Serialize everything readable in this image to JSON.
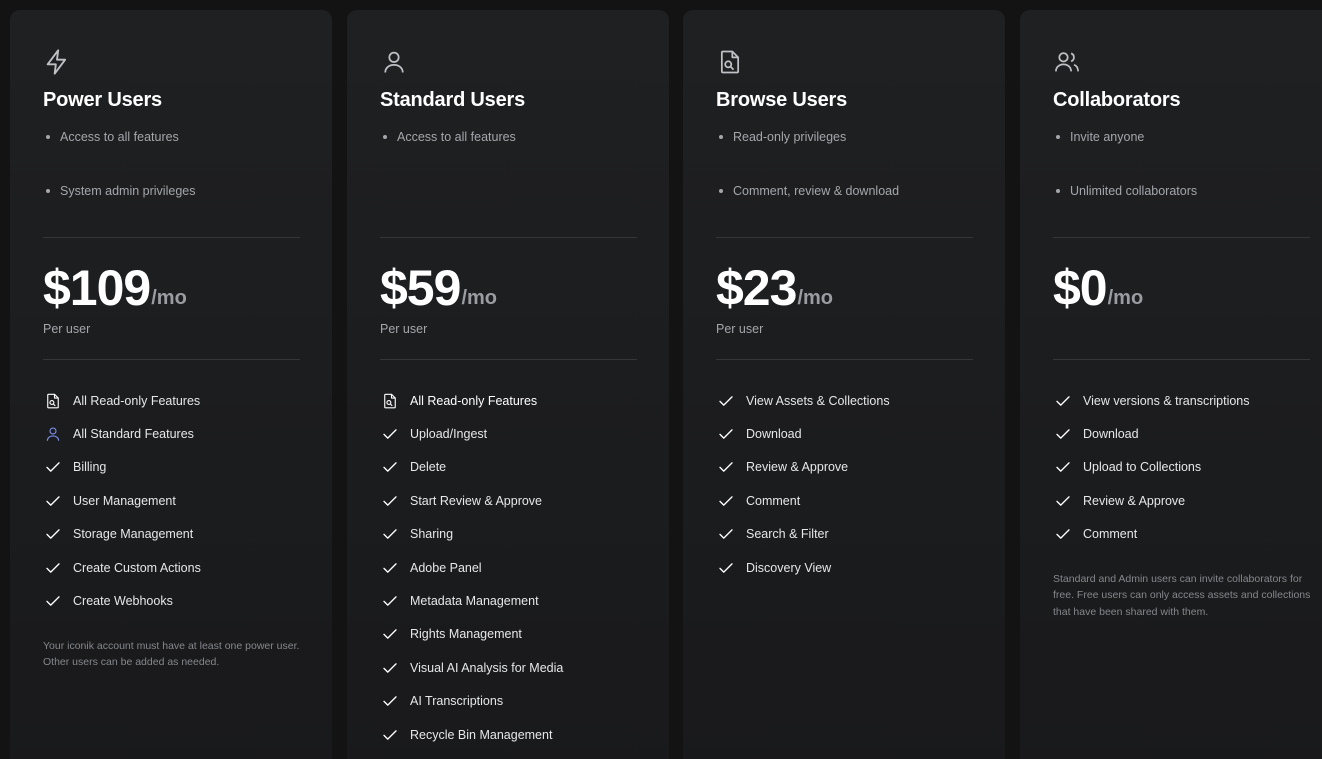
{
  "plans": [
    {
      "title": "Power Users",
      "icon": "lightning-icon",
      "bullets": [
        "Access to all features",
        "System admin privileges"
      ],
      "price": "$109",
      "period": "/mo",
      "per_user": "Per user",
      "features": [
        {
          "label": "All Read-only Features",
          "icon": "file-search-icon"
        },
        {
          "label": "All Standard Features",
          "icon": "user-icon"
        },
        {
          "label": "Billing",
          "icon": "check-icon"
        },
        {
          "label": "User Management",
          "icon": "check-icon"
        },
        {
          "label": "Storage Management",
          "icon": "check-icon"
        },
        {
          "label": "Create Custom Actions",
          "icon": "check-icon"
        },
        {
          "label": "Create Webhooks",
          "icon": "check-icon"
        }
      ],
      "note": "Your iconik account must have at least one power user. Other users can be added as needed."
    },
    {
      "title": "Standard Users",
      "icon": "user-icon",
      "bullets": [
        "Access to all features"
      ],
      "price": "$59",
      "period": "/mo",
      "per_user": "Per user",
      "features": [
        {
          "label": "All Read-only Features",
          "icon": "file-search-icon"
        },
        {
          "label": "Upload/Ingest",
          "icon": "check-icon"
        },
        {
          "label": "Delete",
          "icon": "check-icon"
        },
        {
          "label": "Start Review & Approve",
          "icon": "check-icon"
        },
        {
          "label": "Sharing",
          "icon": "check-icon"
        },
        {
          "label": "Adobe Panel",
          "icon": "check-icon"
        },
        {
          "label": "Metadata Management",
          "icon": "check-icon"
        },
        {
          "label": "Rights Management",
          "icon": "check-icon"
        },
        {
          "label": "Visual AI Analysis for Media",
          "icon": "check-icon"
        },
        {
          "label": "AI Transcriptions",
          "icon": "check-icon"
        },
        {
          "label": "Recycle Bin Management",
          "icon": "check-icon"
        }
      ],
      "note": ""
    },
    {
      "title": "Browse Users",
      "icon": "file-search-icon",
      "bullets": [
        "Read-only privileges",
        "Comment, review & download"
      ],
      "price": "$23",
      "period": "/mo",
      "per_user": "Per user",
      "features": [
        {
          "label": "View Assets & Collections",
          "icon": "check-icon"
        },
        {
          "label": "Download",
          "icon": "check-icon"
        },
        {
          "label": "Review & Approve",
          "icon": "check-icon"
        },
        {
          "label": "Comment",
          "icon": "check-icon"
        },
        {
          "label": "Search & Filter",
          "icon": "check-icon"
        },
        {
          "label": "Discovery View",
          "icon": "check-icon"
        }
      ],
      "note": ""
    },
    {
      "title": "Collaborators",
      "icon": "users-icon",
      "bullets": [
        "Invite anyone",
        "Unlimited collaborators"
      ],
      "price": "$0",
      "period": "/mo",
      "per_user": "",
      "features": [
        {
          "label": "View versions & transcriptions",
          "icon": "check-icon"
        },
        {
          "label": "Download",
          "icon": "check-icon"
        },
        {
          "label": "Upload to Collections",
          "icon": "check-icon"
        },
        {
          "label": "Review & Approve",
          "icon": "check-icon"
        },
        {
          "label": "Comment",
          "icon": "check-icon"
        }
      ],
      "note": "Standard and Admin users can invite collaborators for free. Free users can only access assets and collections that have been shared with them."
    }
  ],
  "colors": {
    "background": "#131314",
    "card": "#1f2022",
    "accent_user_icon": "#7d8fe8"
  }
}
